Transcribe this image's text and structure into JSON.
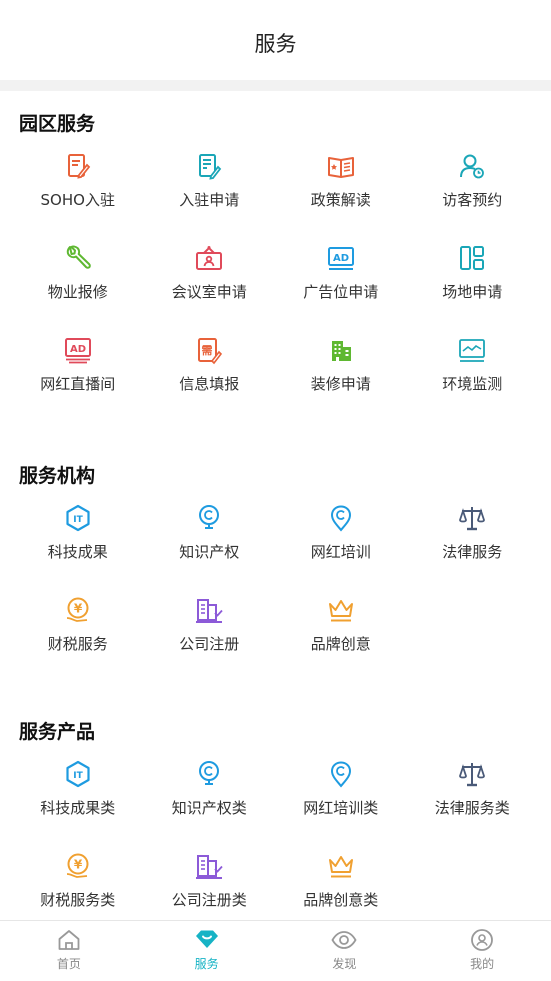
{
  "header": {
    "title": "服务"
  },
  "colors": {
    "accent": "#17b3c5",
    "orange": "#e8623a",
    "teal": "#1aa6b7",
    "green": "#5fb832",
    "red": "#e04a5a",
    "blue": "#1e9be0",
    "slate": "#4a5a78",
    "amber": "#f0a030",
    "purple": "#8c5ad8"
  },
  "sections": [
    {
      "title": "园区服务",
      "items": [
        {
          "label": "SOHO入驻",
          "icon": "document-edit-icon"
        },
        {
          "label": "入驻申请",
          "icon": "form-edit-icon"
        },
        {
          "label": "政策解读",
          "icon": "open-book-icon"
        },
        {
          "label": "访客预约",
          "icon": "visitor-icon"
        },
        {
          "label": "物业报修",
          "icon": "wrench-icon"
        },
        {
          "label": "会议室申请",
          "icon": "meeting-room-icon"
        },
        {
          "label": "广告位申请",
          "icon": "ad-screen-icon"
        },
        {
          "label": "场地申请",
          "icon": "layout-icon"
        },
        {
          "label": "网红直播间",
          "icon": "ad-live-icon"
        },
        {
          "label": "信息填报",
          "icon": "info-form-icon"
        },
        {
          "label": "装修申请",
          "icon": "building-icon"
        },
        {
          "label": "环境监测",
          "icon": "monitor-icon"
        }
      ]
    },
    {
      "title": "服务机构",
      "items": [
        {
          "label": "科技成果",
          "icon": "it-hexagon-icon"
        },
        {
          "label": "知识产权",
          "icon": "copyright-bulb-icon"
        },
        {
          "label": "网红培训",
          "icon": "copyright-pin-icon"
        },
        {
          "label": "法律服务",
          "icon": "scales-icon"
        },
        {
          "label": "财税服务",
          "icon": "yuan-coin-icon"
        },
        {
          "label": "公司注册",
          "icon": "company-icon"
        },
        {
          "label": "品牌创意",
          "icon": "crown-icon"
        }
      ]
    },
    {
      "title": "服务产品",
      "items": [
        {
          "label": "科技成果类",
          "icon": "it-hexagon-icon"
        },
        {
          "label": "知识产权类",
          "icon": "copyright-bulb-icon"
        },
        {
          "label": "网红培训类",
          "icon": "copyright-pin-icon"
        },
        {
          "label": "法律服务类",
          "icon": "scales-icon"
        },
        {
          "label": "财税服务类",
          "icon": "yuan-coin-icon"
        },
        {
          "label": "公司注册类",
          "icon": "company-icon"
        },
        {
          "label": "品牌创意类",
          "icon": "crown-icon"
        }
      ]
    }
  ],
  "tabbar": [
    {
      "label": "首页",
      "icon": "home-icon"
    },
    {
      "label": "服务",
      "icon": "service-diamond-icon",
      "active": true
    },
    {
      "label": "发现",
      "icon": "eye-icon"
    },
    {
      "label": "我的",
      "icon": "profile-icon"
    }
  ]
}
